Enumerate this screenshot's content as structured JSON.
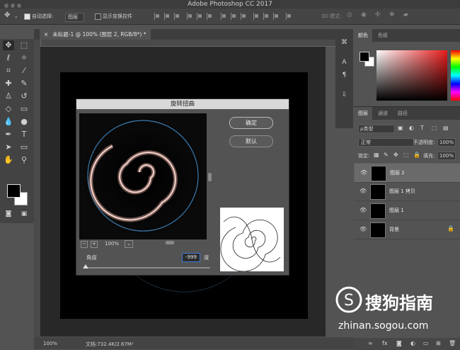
{
  "app": {
    "title": "Adobe Photoshop CC 2017"
  },
  "options": {
    "auto_select_label": "自动选择:",
    "auto_select_value": "图层",
    "show_transform_label": "显示变换控件",
    "mode_3d_label": "3D 模式:"
  },
  "document": {
    "tab_title": "未标题-1 @ 100% (图层 2, RGB/8*) *",
    "zoom": "100%",
    "doc_info": "文档:732.4K/2.67M"
  },
  "dialog": {
    "title": "旋转扭曲",
    "ok_label": "确定",
    "default_label": "默认",
    "zoom_percent": "100%",
    "zoom_out": "−",
    "zoom_in": "+",
    "angle_label": "角度",
    "angle_value": "-999",
    "angle_unit": "度",
    "angle_slider_fraction": 0.0
  },
  "color_panel": {
    "tabs": [
      "颜色",
      "色板"
    ],
    "foreground": "#000000",
    "background": "#ffffff"
  },
  "layers_panel": {
    "tabs": [
      "图层",
      "通道",
      "路径"
    ],
    "filter_kind": "ρ类型",
    "blend_mode": "正常",
    "opacity_label": "不透明度:",
    "opacity_value": "100%",
    "lock_label": "锁定:",
    "fill_label": "填充:",
    "fill_value": "100%",
    "layers": [
      {
        "name": "图层 2",
        "selected": true
      },
      {
        "name": "图层 1 拷贝",
        "selected": false
      },
      {
        "name": "图层 1",
        "selected": false
      },
      {
        "name": "背景",
        "selected": false,
        "locked": true
      }
    ]
  },
  "watermark": {
    "brand": "搜狗指南",
    "url": "zhinan.sogou.com"
  },
  "icons": {
    "move": "move-tool-icon",
    "lock": "lock-icon",
    "eye": "eye-icon"
  }
}
